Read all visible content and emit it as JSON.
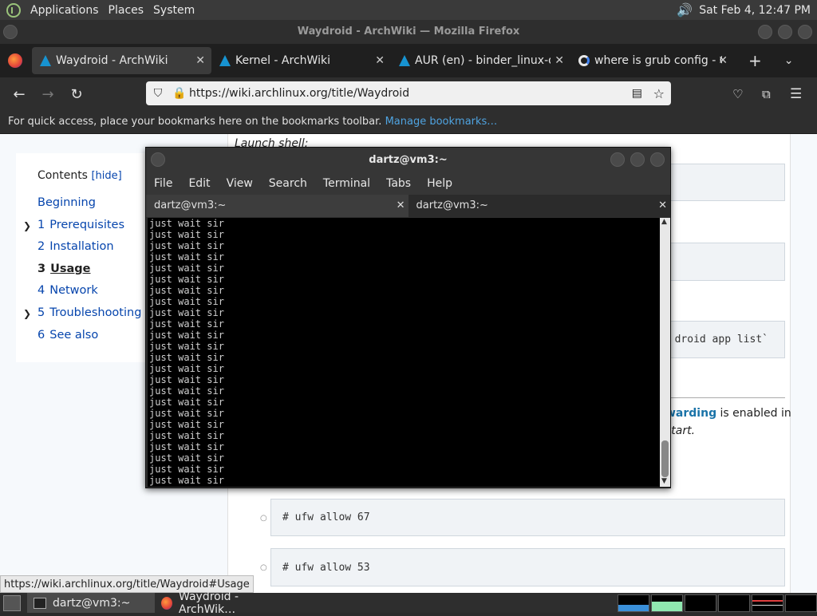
{
  "top_panel": {
    "menus": [
      "Applications",
      "Places",
      "System"
    ],
    "clock": "Sat Feb  4, 12:47 PM"
  },
  "firefox": {
    "title": "Waydroid - ArchWiki — Mozilla Firefox",
    "tabs": [
      {
        "label": "Waydroid - ArchWiki",
        "icon": "archlinux-icon"
      },
      {
        "label": "Kernel - ArchWiki",
        "icon": "archlinux-icon"
      },
      {
        "label": "AUR (en) - binder_linux-dkms",
        "icon": "archlinux-icon"
      },
      {
        "label": "where is grub config - Google",
        "icon": "google-icon"
      }
    ],
    "url": "https://wiki.archlinux.org/title/Waydroid",
    "bookmarks_message": "For quick access, place your bookmarks here on the bookmarks toolbar.",
    "bookmarks_link": "Manage bookmarks…"
  },
  "toc": {
    "title": "Contents",
    "hide": "[hide]",
    "items": [
      {
        "num": "",
        "label": "Beginning"
      },
      {
        "num": "1",
        "label": "Prerequisites"
      },
      {
        "num": "2",
        "label": "Installation"
      },
      {
        "num": "3",
        "label": "Usage"
      },
      {
        "num": "4",
        "label": "Network"
      },
      {
        "num": "5",
        "label": "Troubleshooting"
      },
      {
        "num": "6",
        "label": "See also"
      }
    ]
  },
  "article": {
    "launch_shell": "Launch shell:",
    "partial_app_list": "droid app list`",
    "partial_forwarding": "warding",
    "partial_enabled": " is enabled in",
    "partial_start": "start.",
    "code_ufw_67": "# ufw allow 67",
    "code_ufw_53": "# ufw allow 53"
  },
  "terminal": {
    "title": "dartz@vm3:~",
    "menu": [
      "File",
      "Edit",
      "View",
      "Search",
      "Terminal",
      "Tabs",
      "Help"
    ],
    "tabs": [
      "dartz@vm3:~",
      "dartz@vm3:~"
    ],
    "line_text": "just wait sir",
    "line_count": 24
  },
  "status_url": "https://wiki.archlinux.org/title/Waydroid#Usage",
  "taskbar": {
    "items": [
      "dartz@vm3:~",
      "Waydroid - ArchWik…"
    ]
  }
}
